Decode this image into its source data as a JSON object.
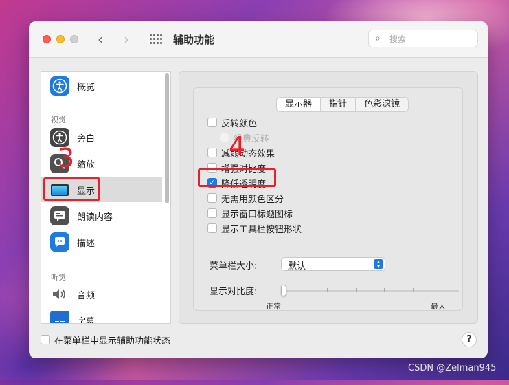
{
  "window": {
    "title": "辅助功能"
  },
  "search": {
    "placeholder": "搜索",
    "icon": "search-icon"
  },
  "sidebar": {
    "items_top": [
      {
        "label": "概览",
        "icon": "accessibility-icon"
      }
    ],
    "section_vision": "视觉",
    "vision_items": [
      {
        "label": "旁白",
        "icon": "voiceover-icon"
      },
      {
        "label": "缩放",
        "icon": "zoom-icon"
      },
      {
        "label": "显示",
        "icon": "display-icon",
        "selected": true
      },
      {
        "label": "朗读内容",
        "icon": "spoken-content-icon"
      },
      {
        "label": "描述",
        "icon": "descriptions-icon"
      }
    ],
    "section_hearing": "听觉",
    "hearing_items": [
      {
        "label": "音频",
        "icon": "speaker-icon"
      },
      {
        "label": "字幕",
        "icon": "captions-icon"
      }
    ]
  },
  "tabs": [
    {
      "label": "显示器",
      "active": true
    },
    {
      "label": "指针",
      "active": false
    },
    {
      "label": "色彩滤镜",
      "active": false
    }
  ],
  "options": [
    {
      "label": "反转颜色",
      "checked": false,
      "disabled": false,
      "indent": false
    },
    {
      "label": "经典反转",
      "checked": false,
      "disabled": true,
      "indent": true
    },
    {
      "label": "减弱动态效果",
      "checked": false,
      "disabled": false,
      "indent": false
    },
    {
      "label": "增强对比度",
      "checked": false,
      "disabled": false,
      "indent": false
    },
    {
      "label": "降低透明度",
      "checked": true,
      "disabled": false,
      "indent": false
    },
    {
      "label": "无需用颜色区分",
      "checked": false,
      "disabled": false,
      "indent": false
    },
    {
      "label": "显示窗口标题图标",
      "checked": false,
      "disabled": false,
      "indent": false
    },
    {
      "label": "显示工具栏按钮形状",
      "checked": false,
      "disabled": false,
      "indent": false
    }
  ],
  "menubar_size": {
    "label": "菜单栏大小:",
    "value": "默认"
  },
  "contrast": {
    "label": "显示对比度:",
    "min_label": "正常",
    "max_label": "最大",
    "level": 0
  },
  "bottom": {
    "label": "在菜单栏中显示辅助功能状态",
    "help": "?"
  },
  "annotations": {
    "three": "3",
    "four": "4"
  },
  "watermark": "CSDN @Zelman945",
  "colors": {
    "accent": "#1f7ae0",
    "annotation": "#e8202a"
  }
}
